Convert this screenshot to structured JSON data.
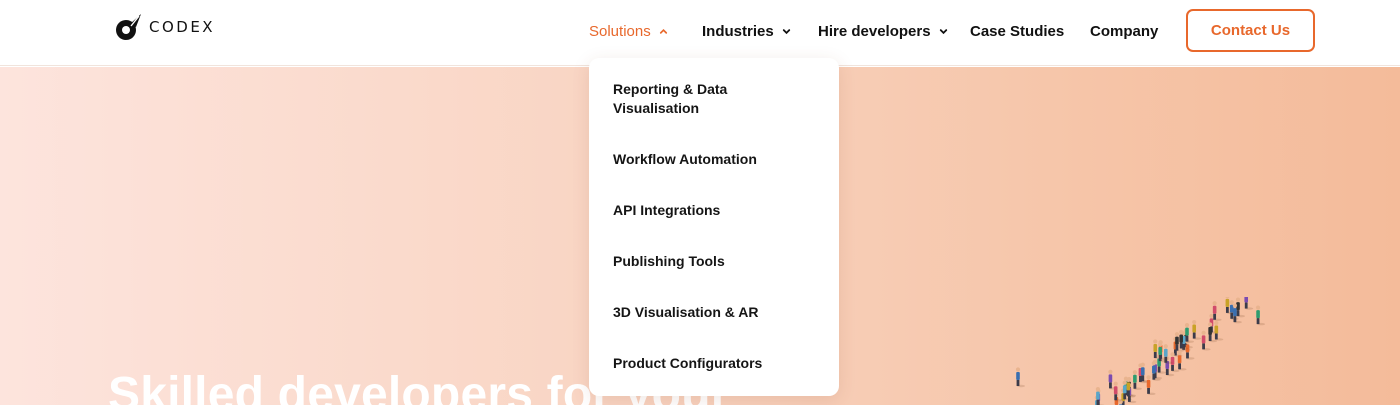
{
  "brand": {
    "logo_text": "CODEX"
  },
  "nav": {
    "solutions": "Solutions",
    "industries": "Industries",
    "hire_developers": "Hire developers",
    "case_studies": "Case Studies",
    "company": "Company"
  },
  "contact_button": "Contact Us",
  "dropdown": {
    "items": [
      "Reporting & Data Visualisation",
      "Workflow Automation",
      "API Integrations",
      "Publishing Tools",
      "3D Visualisation & AR",
      "Product Configurators"
    ]
  },
  "hero": {
    "headline": "Skilled developers for your"
  },
  "colors": {
    "accent": "#e8682c",
    "text": "#111111",
    "hero_gradient_start": "#fde4dd",
    "hero_gradient_end": "#f4bb9a"
  },
  "icons": {
    "logo": "rocket-ring-icon",
    "chevron_up": "chevron-up-icon",
    "chevron_down": "chevron-down-icon"
  }
}
